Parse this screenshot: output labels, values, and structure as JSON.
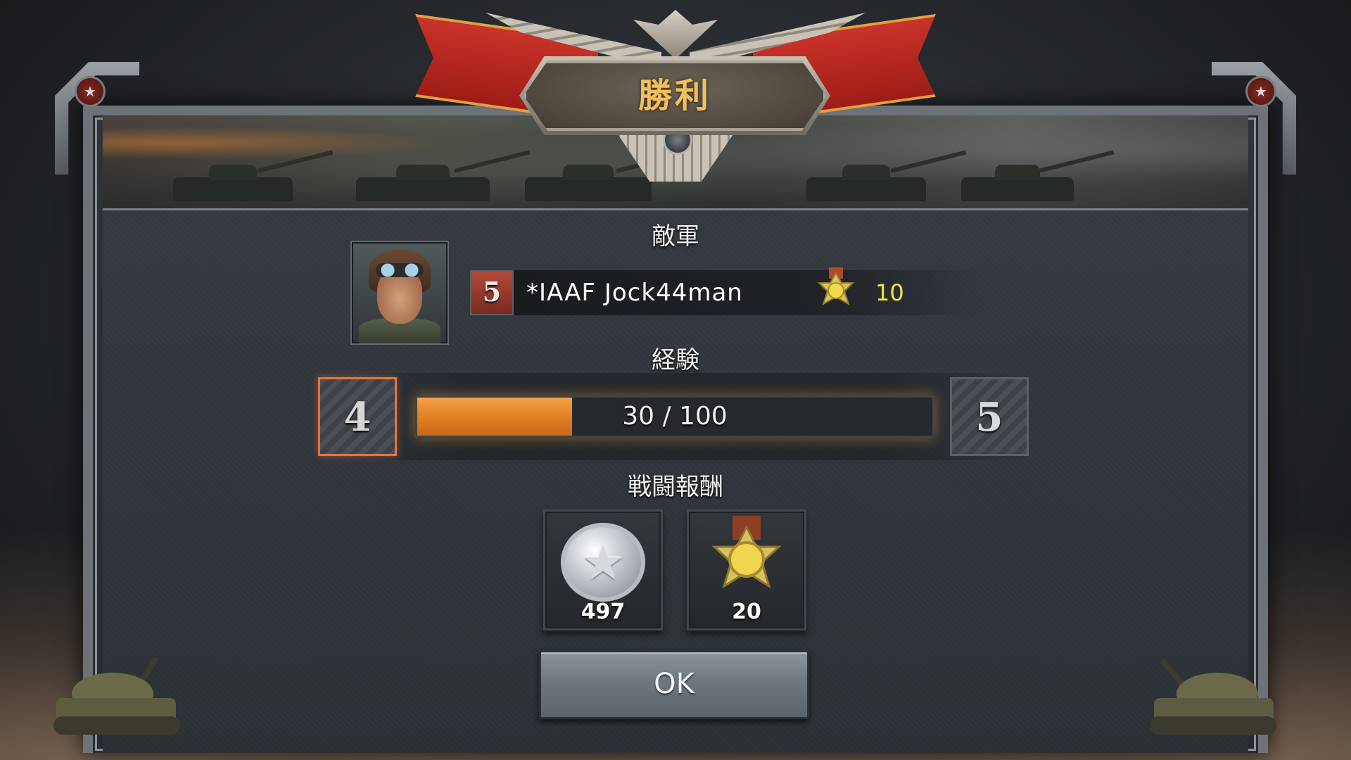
{
  "title": "勝利",
  "sections": {
    "enemy_heading": "敵軍",
    "xp_heading": "経験",
    "rewards_heading": "戦闘報酬"
  },
  "enemy": {
    "rank": "5",
    "name": "*IAAF Jock44man",
    "medal_value": "10"
  },
  "experience": {
    "current_level": "4",
    "next_level": "5",
    "current": 30,
    "max": 100,
    "text": "30 / 100"
  },
  "rewards": [
    {
      "icon": "silver-coin-icon",
      "count": "497"
    },
    {
      "icon": "gold-medal-icon",
      "count": "20"
    }
  ],
  "ok_button": "OK",
  "colors": {
    "title_gold": "#f0c060",
    "xp_orange": "#e8812a",
    "medal_yellow": "#f4e24a",
    "ribbon_red": "#b52820"
  }
}
